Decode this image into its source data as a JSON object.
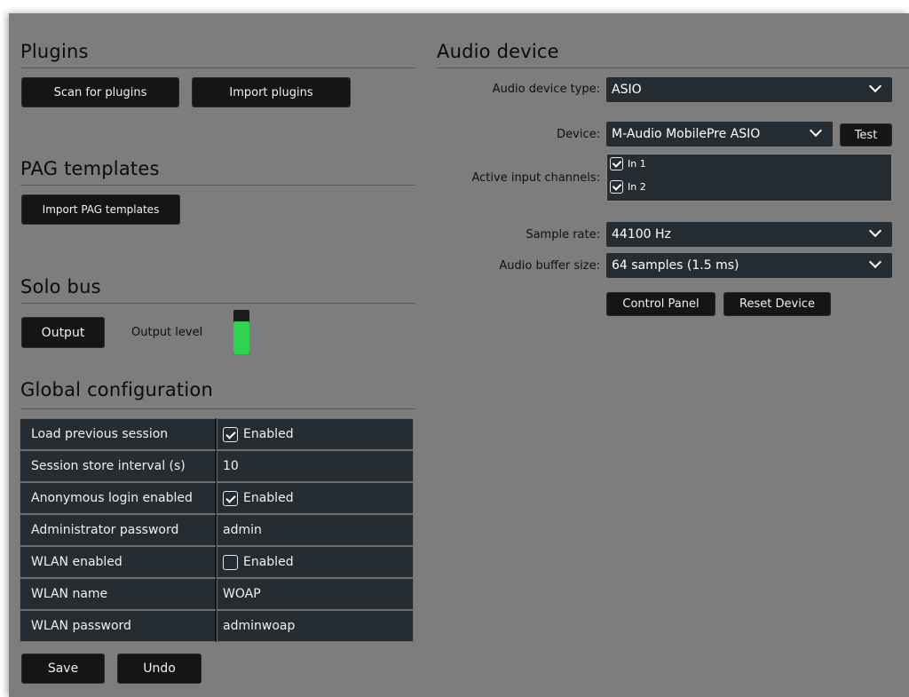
{
  "plugins": {
    "title": "Plugins",
    "scan_label": "Scan for plugins",
    "import_label": "Import plugins"
  },
  "pag": {
    "title": "PAG templates",
    "import_label": "Import PAG templates"
  },
  "solo": {
    "title": "Solo bus",
    "output_label": "Output",
    "level_label": "Output level",
    "level_fraction": 0.74,
    "level_color": "#2fd44e"
  },
  "global": {
    "title": "Global configuration",
    "rows": [
      {
        "label": "Load previous session",
        "type": "checkbox",
        "checked": true,
        "value": "Enabled"
      },
      {
        "label": "Session store interval (s)",
        "type": "text",
        "value": "10"
      },
      {
        "label": "Anonymous login enabled",
        "type": "checkbox",
        "checked": true,
        "value": "Enabled"
      },
      {
        "label": "Administrator password",
        "type": "text",
        "value": "admin"
      },
      {
        "label": "WLAN enabled",
        "type": "checkbox",
        "checked": false,
        "value": "Enabled"
      },
      {
        "label": "WLAN name",
        "type": "text",
        "value": "WOAP"
      },
      {
        "label": "WLAN password",
        "type": "text",
        "value": "adminwoap"
      }
    ],
    "save_label": "Save",
    "undo_label": "Undo"
  },
  "audio": {
    "title": "Audio device",
    "type_label": "Audio device type:",
    "type_value": "ASIO",
    "device_label": "Device:",
    "device_value": "M-Audio MobilePre ASIO",
    "test_label": "Test",
    "channels_label": "Active input channels:",
    "channels": [
      {
        "label": "In 1",
        "checked": true
      },
      {
        "label": "In 2",
        "checked": true
      }
    ],
    "rate_label": "Sample rate:",
    "rate_value": "44100 Hz",
    "buffer_label": "Audio buffer size:",
    "buffer_value": "64 samples (1.5 ms)",
    "control_panel_label": "Control Panel",
    "reset_label": "Reset Device"
  },
  "colors": {
    "background": "#7d7d7d",
    "panel": "#252d33",
    "button": "#151515",
    "meter": "#2fd44e"
  },
  "icons": {
    "dropdown": "chevron-down-icon",
    "check": "checkbox-icon"
  }
}
